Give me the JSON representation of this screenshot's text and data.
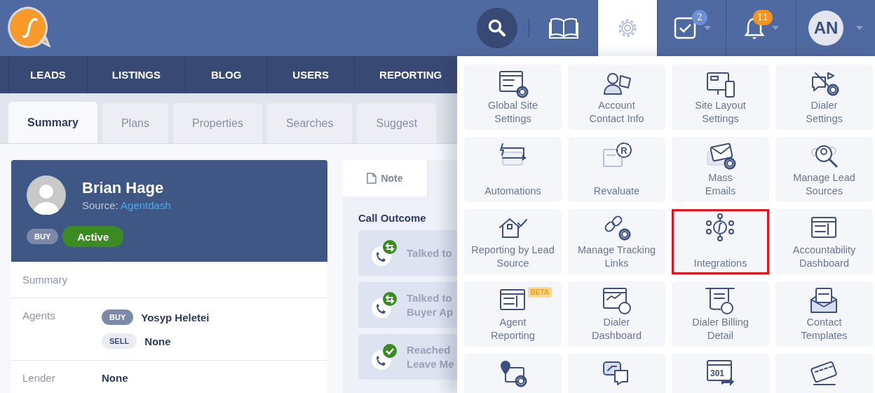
{
  "header": {
    "avatar_initials": "AN",
    "tasks_badge": "2",
    "notifications_badge": "11"
  },
  "nav": [
    "LEADS",
    "LISTINGS",
    "BLOG",
    "USERS",
    "REPORTING"
  ],
  "tabs": [
    {
      "label": "Summary",
      "selected": true
    },
    {
      "label": "Plans",
      "selected": false
    },
    {
      "label": "Properties",
      "selected": false
    },
    {
      "label": "Searches",
      "selected": false
    },
    {
      "label": "Suggest",
      "selected": false
    }
  ],
  "lead": {
    "name": "Brian Hage",
    "source_label": "Source:",
    "source": "Agentdash",
    "type_tag": "BUY",
    "status": "Active",
    "summary_label": "Summary",
    "agents_label": "Agents",
    "agents": [
      {
        "tag": "BUY",
        "kind": "filled",
        "name": "Yosyp Heletei"
      },
      {
        "tag": "SELL",
        "kind": "plain",
        "name": "None"
      }
    ],
    "lender_label": "Lender",
    "lender": "None"
  },
  "activity": {
    "tabs": [
      {
        "label": "Note",
        "selected": true
      }
    ],
    "section_title": "Call Outcome",
    "outcomes": [
      {
        "kind": "swap",
        "lines": [
          "Talked to"
        ]
      },
      {
        "kind": "swap",
        "lines": [
          "Talked to",
          "Buyer Ap"
        ]
      },
      {
        "kind": "check",
        "lines": [
          "Reached",
          "Leave Me"
        ]
      }
    ]
  },
  "settings_menu": {
    "tiles": [
      {
        "lines": [
          "Global Site",
          "Settings"
        ],
        "highlighted": false
      },
      {
        "lines": [
          "Account",
          "Contact Info"
        ],
        "highlighted": false
      },
      {
        "lines": [
          "Site Layout",
          "Settings"
        ],
        "highlighted": false
      },
      {
        "lines": [
          "Dialer",
          "Settings"
        ],
        "highlighted": false
      },
      {
        "lines": [
          "Automations"
        ],
        "highlighted": false
      },
      {
        "lines": [
          "Revaluate"
        ],
        "icon_text": "R",
        "highlighted": false
      },
      {
        "lines": [
          "Mass",
          "Emails"
        ],
        "highlighted": false
      },
      {
        "lines": [
          "Manage Lead",
          "Sources"
        ],
        "highlighted": false
      },
      {
        "lines": [
          "Reporting by Lead",
          "Source"
        ],
        "highlighted": false
      },
      {
        "lines": [
          "Manage Tracking",
          "Links"
        ],
        "highlighted": false
      },
      {
        "lines": [
          "Integrations"
        ],
        "highlighted": true
      },
      {
        "lines": [
          "Accountability",
          "Dashboard"
        ],
        "highlighted": false
      },
      {
        "lines": [
          "Agent",
          "Reporting"
        ],
        "badge": "BETA",
        "highlighted": false
      },
      {
        "lines": [
          "Dialer",
          "Dashboard"
        ],
        "highlighted": false
      },
      {
        "lines": [
          "Dialer Billing",
          "Detail"
        ],
        "highlighted": false
      },
      {
        "lines": [
          "Contact",
          "Templates"
        ],
        "highlighted": false
      },
      {
        "highlighted": false
      },
      {
        "highlighted": false
      },
      {
        "icon_text": "301",
        "highlighted": false
      },
      {
        "highlighted": false
      }
    ]
  }
}
